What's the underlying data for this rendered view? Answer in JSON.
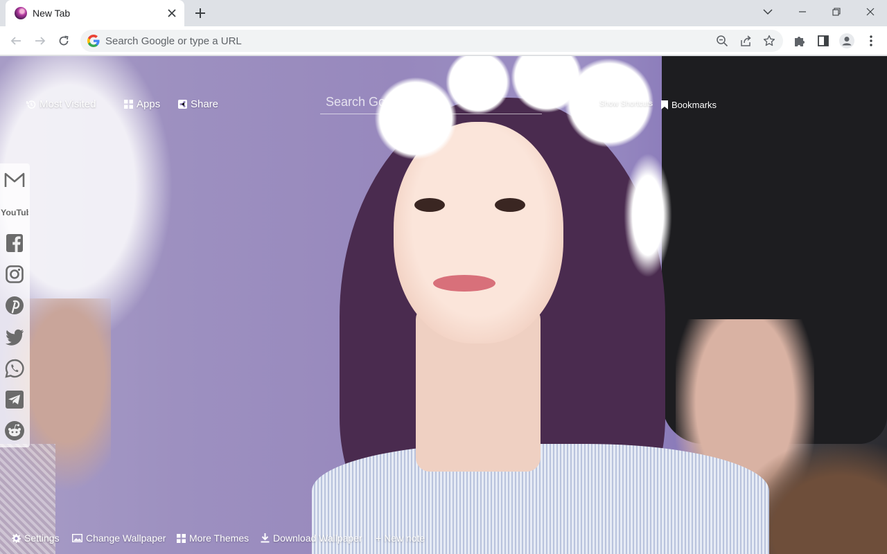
{
  "tab": {
    "title": "New Tab"
  },
  "omnibox": {
    "placeholder": "Search Google or type a URL"
  },
  "page": {
    "top_nav": {
      "most_visited": "Most Visited",
      "apps": "Apps",
      "share": "Share",
      "show_shortcuts": "Show Shortcuts",
      "bookmarks": "Bookmarks"
    },
    "search": {
      "placeholder": "Search Google"
    },
    "social_links": [
      {
        "icon": "gmail-icon"
      },
      {
        "icon": "youtube-icon"
      },
      {
        "icon": "facebook-icon"
      },
      {
        "icon": "instagram-icon"
      },
      {
        "icon": "pinterest-icon"
      },
      {
        "icon": "twitter-icon"
      },
      {
        "icon": "whatsapp-icon"
      },
      {
        "icon": "telegram-icon"
      },
      {
        "icon": "reddit-icon"
      }
    ],
    "youtube_logo_text": "YouTube",
    "bottom_nav": {
      "settings": "Settings",
      "change_wallpaper": "Change Wallpaper",
      "more_themes": "More Themes",
      "download_wallpaper": "Download Wallpaper",
      "new_note": "+ New note"
    }
  }
}
